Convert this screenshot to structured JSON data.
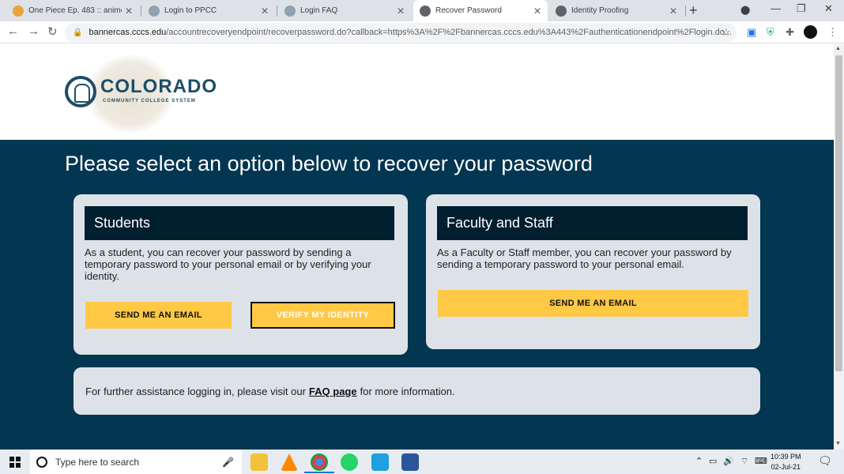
{
  "browser": {
    "tabs": [
      {
        "title": "One Piece Ep. 483 :: animepahe",
        "favicon_color": "#e8a33d",
        "active": false
      },
      {
        "title": "Login to PPCC",
        "favicon_color": "#8fa3b0",
        "active": false
      },
      {
        "title": "Login FAQ",
        "favicon_color": "#8fa3b0",
        "active": false
      },
      {
        "title": "Recover Password",
        "favicon_color": "#5f6368",
        "active": true
      },
      {
        "title": "Identity Proofing",
        "favicon_color": "#5f6368",
        "active": false
      }
    ],
    "url_host": "bannercas.cccs.edu",
    "url_path": "/accountrecoveryendpoint/recoverpassword.do?callback=https%3A%2F%2Fbannercas.cccs.edu%3A443%2Fauthenticationendpoint%2Flogin.do..."
  },
  "header": {
    "brand_name": "COLORADO",
    "brand_sub": "COMMUNITY COLLEGE SYSTEM"
  },
  "main": {
    "heading": "Please select an option below to recover your password",
    "students": {
      "title": "Students",
      "text": "As a student, you can recover your password by sending a temporary password to your personal email or by verifying your identity.",
      "email_button": "SEND ME AN EMAIL",
      "verify_button": "VERIFY MY IDENTITY"
    },
    "faculty": {
      "title": "Faculty and Staff",
      "text": "As a Faculty or Staff member, you can recover your password by sending a temporary password to your personal email.",
      "email_button": "SEND ME AN EMAIL"
    },
    "assist": {
      "prefix": "For further assistance logging in, please visit our",
      "link": "FAQ page",
      "suffix": "for more information."
    }
  },
  "taskbar": {
    "search_placeholder": "Type here to search",
    "time": "10:39 PM",
    "date": "02-Jul-21"
  },
  "colors": {
    "accent_yellow": "#ffc845",
    "navy": "#023651",
    "card_header": "#021f30"
  }
}
